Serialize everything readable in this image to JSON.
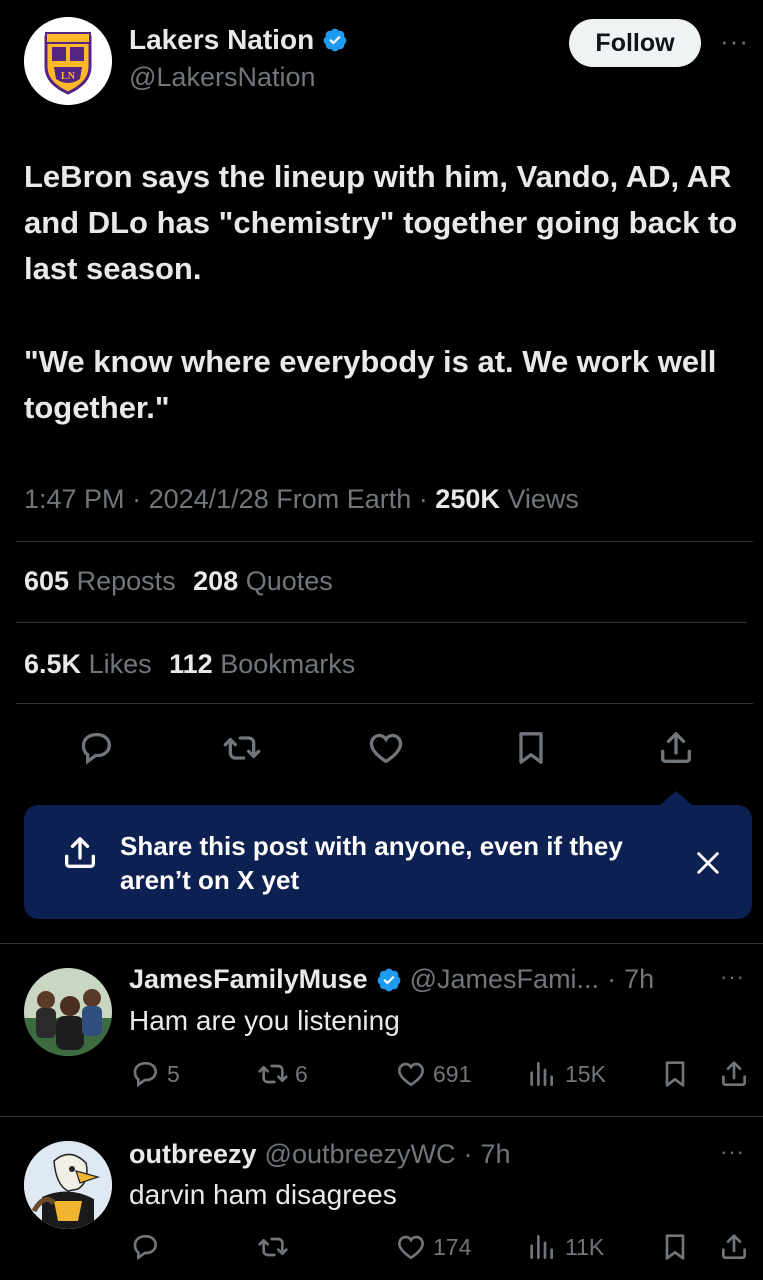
{
  "post": {
    "display_name": "Lakers Nation",
    "handle": "@LakersNation",
    "follow_label": "Follow",
    "more_label": "···",
    "text_p1": "LeBron says the lineup with him, Vando, AD, AR and DLo has \"chemistry\" together going back to last season.",
    "text_p2": "\"We know where everybody is at. We work well together.\"",
    "time": "1:47 PM",
    "date": "2024/1/28",
    "source": "From Earth",
    "views_count": "250K",
    "views_label": "Views",
    "reposts_count": "605",
    "reposts_label": "Reposts",
    "quotes_count": "208",
    "quotes_label": "Quotes",
    "likes_count": "6.5K",
    "likes_label": "Likes",
    "bookmarks_count": "112",
    "bookmarks_label": "Bookmarks",
    "dot": "·"
  },
  "share_prompt": {
    "text": "Share this post with anyone, even if they aren’t on X yet"
  },
  "replies": [
    {
      "name": "JamesFamilyMuse",
      "handle": "@JamesFami...",
      "time": "7h",
      "text": "Ham are you listening",
      "replies": "5",
      "reposts": "6",
      "likes": "691",
      "views": "15K"
    },
    {
      "name": "outbreezy",
      "handle": "@outbreezyWC",
      "time": "7h",
      "text": "darvin ham disagrees",
      "replies": "",
      "reposts": "",
      "likes": "174",
      "views": "11K"
    }
  ],
  "logo_text": [
    "LAKERSNATION.COM",
    "LN"
  ],
  "colors": {
    "background": "#000000",
    "text": "#e7e9ea",
    "secondary": "#71767b",
    "verified": "#1d9bf0",
    "share_bg": "#0d2052",
    "lakers_purple": "#552583",
    "lakers_gold": "#fdb927"
  }
}
